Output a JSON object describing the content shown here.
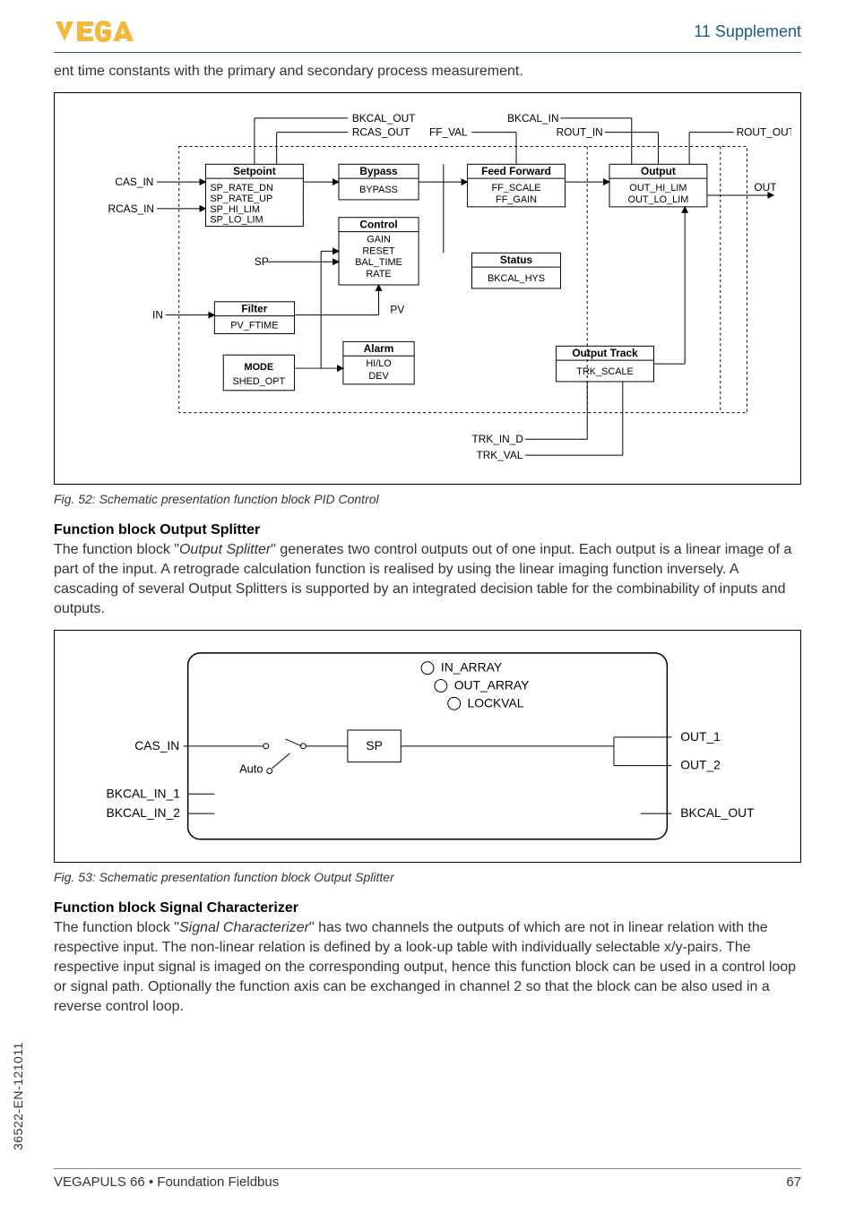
{
  "header": {
    "section": "11 Supplement"
  },
  "intro": "ent time constants with the primary and secondary process measurement.",
  "fig52": {
    "caption": "Fig. 52: Schematic presentation function block PID Control",
    "labels": {
      "bkcal_out": "BKCAL_OUT",
      "rcas_out": "RCAS_OUT",
      "ff_val": "FF_VAL",
      "bkcal_in": "BKCAL_IN",
      "rout_in": "ROUT_IN",
      "rout_out": "ROUT_OUT",
      "cas_in": "CAS_IN",
      "rcas_in": "RCAS_IN",
      "out": "OUT",
      "sp": "SP",
      "in": "IN",
      "pv": "PV",
      "trk_in_d": "TRK_IN_D",
      "trk_val": "TRK_VAL",
      "setpoint_title": "Setpoint",
      "setpoint_l1": "SP_RATE_DN",
      "setpoint_l2": "SP_RATE_UP",
      "setpoint_l3": "SP_HI_LIM",
      "setpoint_l4": "SP_LO_LIM",
      "bypass_title": "Bypass",
      "bypass_l1": "BYPASS",
      "feedfwd_title": "Feed Forward",
      "feedfwd_l1": "FF_SCALE",
      "feedfwd_l2": "FF_GAIN",
      "output_title": "Output",
      "output_l1": "OUT_HI_LIM",
      "output_l2": "OUT_LO_LIM",
      "control_title": "Control",
      "control_l1": "GAIN",
      "control_l2": "RESET",
      "control_l3": "BAL_TIME",
      "control_l4": "RATE",
      "status_title": "Status",
      "status_l1": "BKCAL_HYS",
      "filter_title": "Filter",
      "filter_l1": "PV_FTIME",
      "mode_l1": "MODE",
      "mode_l2": "SHED_OPT",
      "alarm_title": "Alarm",
      "alarm_l1": "HI/LO",
      "alarm_l2": "DEV",
      "otrack_title": "Output Track",
      "otrack_l1": "TRK_SCALE"
    }
  },
  "splitter": {
    "heading": "Function block Output Splitter",
    "text_pre": "The function block \"",
    "text_em": "Output Splitter",
    "text_post": "\" generates two control outputs out of one input. Each output is a linear image of a part of the input. A retrograde calculation function is realised by using the linear imaging function inversely. A cascading of several Output Splitters is supported by an integrated decision table for the combinability of inputs and outputs."
  },
  "fig53": {
    "caption": "Fig. 53: Schematic presentation function block Output Splitter",
    "labels": {
      "in_array": "IN_ARRAY",
      "out_array": "OUT_ARRAY",
      "lockval": "LOCKVAL",
      "cas_in": "CAS_IN",
      "sp": "SP",
      "auto": "Auto",
      "out1": "OUT_1",
      "out2": "OUT_2",
      "bkcal_in_1": "BKCAL_IN_1",
      "bkcal_in_2": "BKCAL_IN_2",
      "bkcal_out": "BKCAL_OUT"
    }
  },
  "signalchar": {
    "heading": "Function block Signal Characterizer",
    "text_pre": "The function block \"",
    "text_em": "Signal Characterizer",
    "text_post": "\" has two channels the outputs of which are not in linear relation with the respective input. The non-linear relation is defined by a look-up table with individually selectable x/y-pairs. The respective input signal is imaged on the corresponding output, hence this function block can be used in a control loop or signal path. Optionally the function axis can be exchanged in channel 2 so that the block can be also used in a reverse control loop."
  },
  "footer": {
    "left": "VEGAPULS 66 • Foundation Fieldbus",
    "right": "67"
  },
  "side_code": "36522-EN-121011"
}
